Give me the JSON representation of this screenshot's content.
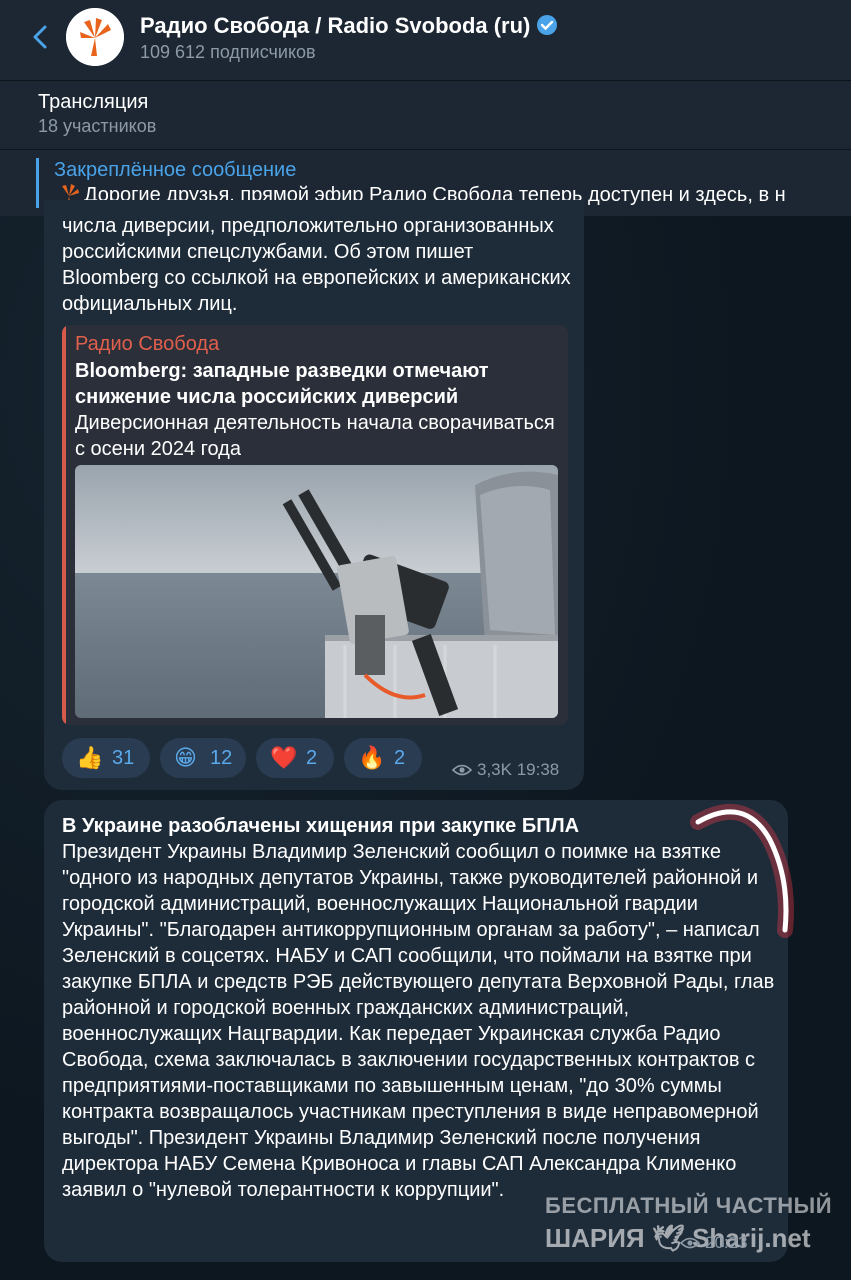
{
  "header": {
    "back_icon": "chevron-left-icon",
    "channel_name": "Радио Свобода / Radio Svoboda (ru)",
    "subscribers": "109 612 подписчиков"
  },
  "stream": {
    "title": "Трансляция",
    "participants": "18 участников"
  },
  "pinned": {
    "label": "Закреплённое сообщение",
    "text": "Дорогие друзья, прямой эфир Радио Свобода теперь доступен и здесь, в н"
  },
  "message1": {
    "text": "числа диверсии, предположительно организованных российскими спецслужбами. Об этом пишет Bloomberg со ссылкой на европейских и американских официальных лиц.",
    "preview": {
      "site": "Радио Свобода",
      "headline": "Bloomberg: западные разведки отмечают снижение числа российских диверсий",
      "description": "Диверсионная деятельность начала сворачиваться с осени 2024 года"
    },
    "reactions": [
      {
        "emoji": "👍",
        "count": "31"
      },
      {
        "emoji": "😁",
        "count": "12"
      },
      {
        "emoji": "❤️",
        "count": "2"
      },
      {
        "emoji": "🔥",
        "count": "2"
      }
    ],
    "views": "3,3K",
    "time": "19:38"
  },
  "message2": {
    "title": "В Украине разоблачены хищения при закупке БПЛА",
    "text": "Президент Украины Владимир Зеленский сообщил о поимке на взятке \"одного из народных депутатов Украины, также руководителей районной и городской администраций, военнослужащих Национальной гвардии Украины\". \"Благодарен  антикоррупционным органам за работу\", – написал Зеленский в соцсетях. НАБУ и САП сообщили, что поймали на взятке при закупке БПЛА и средств РЭБ действующего депутата Верховной Рады, глав районной и городской военных гражданских администраций, военнослужащих Нацгвардии. Как передает Украинская служба Радио Свобода, схема заключалась в заключении государственных контрактов с предприятиями-поставщиками по завышенным ценам, \"до 30% суммы контракта возвращалось участникам преступления в виде неправомерной выгоды\". Президент Украины Владимир Зеленский после получения директора НАБУ Семена Кривоноса и главы САП Александра Клименко заявил о \"нулевой толерантности к коррупции\".",
    "time": "20:23"
  },
  "watermark": {
    "line1": "БЕСПЛАТНЫЙ ЧАСТНЫЙ",
    "line2": "ШАРИЯ 🕊 Sharij.net"
  },
  "colors": {
    "accent": "#4aa3e8",
    "bubble": "#1e2c3a",
    "link_preview_bar": "#d75a4a"
  }
}
